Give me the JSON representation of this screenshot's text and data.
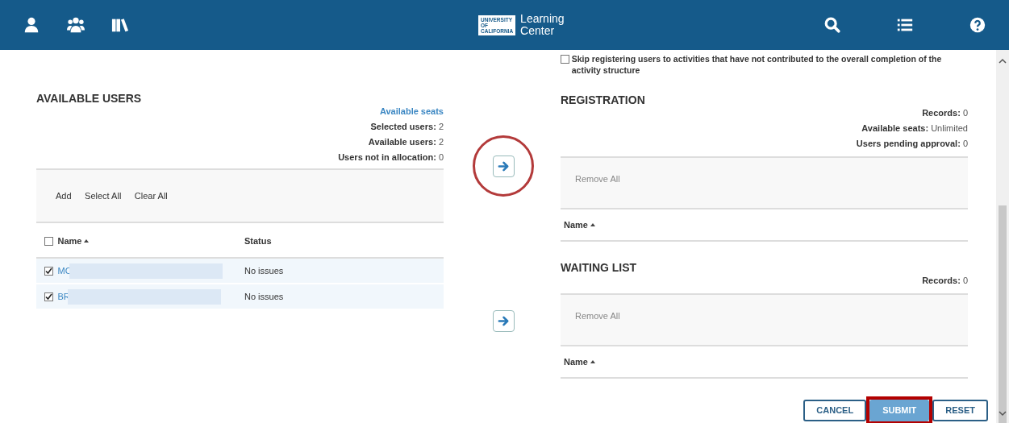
{
  "logo": {
    "seal_lines": [
      "UNIVERSITY",
      "OF",
      "CALIFORNIA"
    ],
    "title_lines": [
      "Learning",
      "Center"
    ]
  },
  "skip_option": {
    "label": "Skip registering users to activities that have not contributed to the overall completion of the activity structure",
    "checked": false
  },
  "available_users": {
    "title": "AVAILABLE USERS",
    "summary": [
      {
        "kind": "link",
        "label": "Available seats"
      },
      {
        "kind": "stat",
        "label": "Selected users:",
        "value": "2"
      },
      {
        "kind": "stat",
        "label": "Available users:",
        "value": "2"
      },
      {
        "kind": "stat",
        "label": "Users not in allocation:",
        "value": "0"
      }
    ],
    "actions": [
      "Add",
      "Select All",
      "Clear All"
    ],
    "header_checked": false,
    "columns": [
      "Name",
      "Status"
    ],
    "rows": [
      {
        "name": "MC",
        "status": "No issues",
        "checked": true
      },
      {
        "name": "BR",
        "status": "No issues",
        "checked": true
      }
    ]
  },
  "transfer_buttons": [
    {
      "highlighted": true
    },
    {
      "highlighted": false
    }
  ],
  "registration": {
    "title": "REGISTRATION",
    "summary": [
      {
        "label": "Records:",
        "value": "0"
      },
      {
        "label": "Available seats:",
        "value": "Unlimited"
      },
      {
        "label": "Users pending approval:",
        "value": "0"
      }
    ],
    "actions": [
      "Remove All"
    ],
    "columns": [
      "Name"
    ]
  },
  "waiting_list": {
    "title": "WAITING LIST",
    "summary": [
      {
        "label": "Records:",
        "value": "0"
      }
    ],
    "actions": [
      "Remove All"
    ],
    "columns": [
      "Name"
    ]
  },
  "footer_buttons": [
    {
      "label": "CANCEL",
      "kind": "outline",
      "highlighted": false
    },
    {
      "label": "SUBMIT",
      "kind": "primary",
      "highlighted": true
    },
    {
      "label": "RESET",
      "kind": "outline",
      "highlighted": false
    }
  ]
}
